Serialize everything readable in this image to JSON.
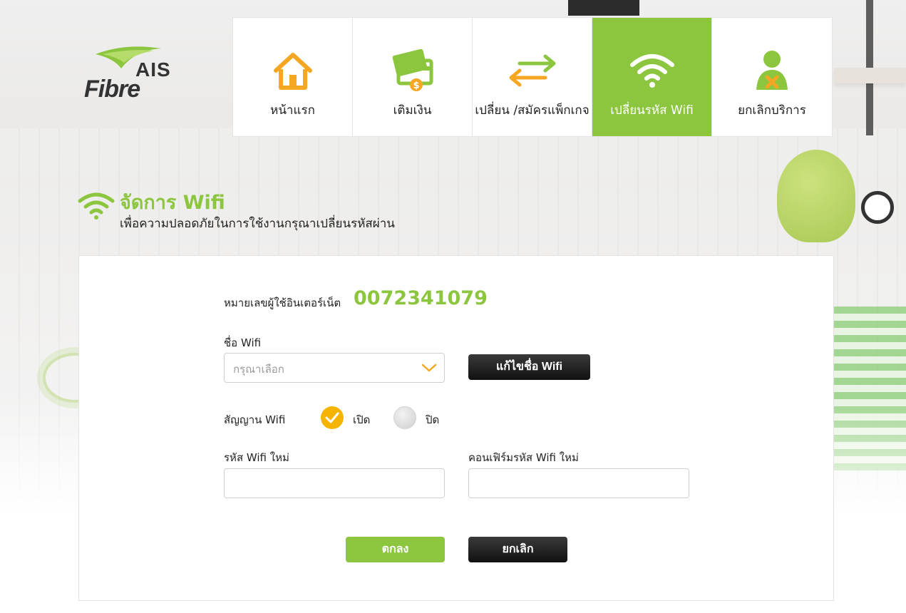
{
  "logo": {
    "brand": "AIS",
    "product": "Fibre"
  },
  "nav": {
    "items": [
      {
        "label": "หน้าแรก",
        "icon": "home-icon",
        "active": false
      },
      {
        "label": "เติมเงิน",
        "icon": "topup-card-icon",
        "active": false
      },
      {
        "label": "เปลี่ยน /สมัครแพ็กเกจ",
        "icon": "swap-arrows-icon",
        "active": false
      },
      {
        "label": "เปลี่ยนรหัส Wifi",
        "icon": "wifi-icon",
        "active": true
      },
      {
        "label": "ยกเลิกบริการ",
        "icon": "cancel-user-icon",
        "active": false
      }
    ]
  },
  "section": {
    "title": "จัดการ Wifi",
    "subtitle": "เพื่อความปลอดภัยในการใช้งานกรุณาเปลี่ยนรหัสผ่าน"
  },
  "form": {
    "account_label": "หมายเลขผู้ใช้อินเตอร์เน็ต",
    "account_number": "0072341079",
    "wifi_name_label": "ชื่อ Wifi",
    "wifi_name_placeholder": "กรุณาเลือก",
    "edit_wifi_button": "แก้ไขชื่อ Wifi",
    "signal_label": "สัญญาน Wifi",
    "signal_on_label": "เปิด",
    "signal_off_label": "ปิด",
    "signal_selected": "on",
    "new_password_label": "รหัส Wifi ใหม่",
    "confirm_password_label": "คอนเฟิร์มรหัส Wifi ใหม่",
    "new_password_value": "",
    "confirm_password_value": "",
    "submit_button": "ตกลง",
    "cancel_button": "ยกเลิก"
  },
  "colors": {
    "accent": "#8cc63f",
    "radio_on": "#f5b400",
    "icon_orange": "#f5a623",
    "dark_button": "#1a1a1a"
  }
}
